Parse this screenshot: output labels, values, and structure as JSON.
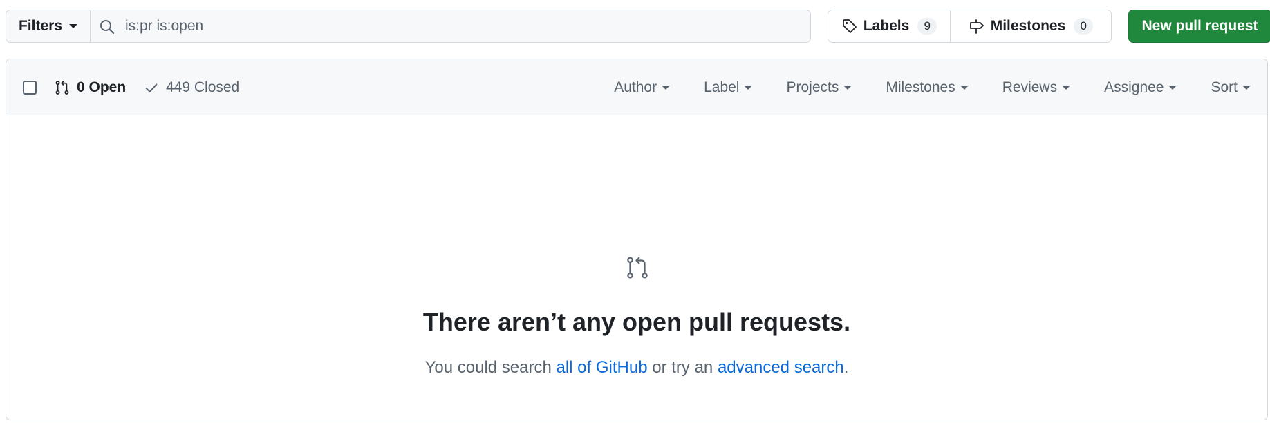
{
  "filters": {
    "button_label": "Filters",
    "search_value": "is:pr is:open"
  },
  "labels_button": {
    "label": "Labels",
    "count": "9"
  },
  "milestones_button": {
    "label": "Milestones",
    "count": "0"
  },
  "new_pr_button": {
    "label": "New pull request",
    "color": "#1f883d"
  },
  "list_header": {
    "open_label": "0 Open",
    "closed_label": "449 Closed",
    "menus": [
      "Author",
      "Label",
      "Projects",
      "Milestones",
      "Reviews",
      "Assignee",
      "Sort"
    ]
  },
  "blankslate": {
    "title": "There aren’t any open pull requests.",
    "desc_prefix": "You could search ",
    "link1": "all of GitHub",
    "desc_middle": " or try an ",
    "link2": "advanced search",
    "desc_suffix": "."
  },
  "colors": {
    "link": "#0969da",
    "muted_text": "#59636e",
    "header_bg": "#f6f8fa",
    "border": "#d0d7de"
  },
  "icons": [
    "search-icon",
    "tag-icon",
    "milestone-icon",
    "git-pull-request-icon",
    "check-icon",
    "chevron-down-icon"
  ]
}
